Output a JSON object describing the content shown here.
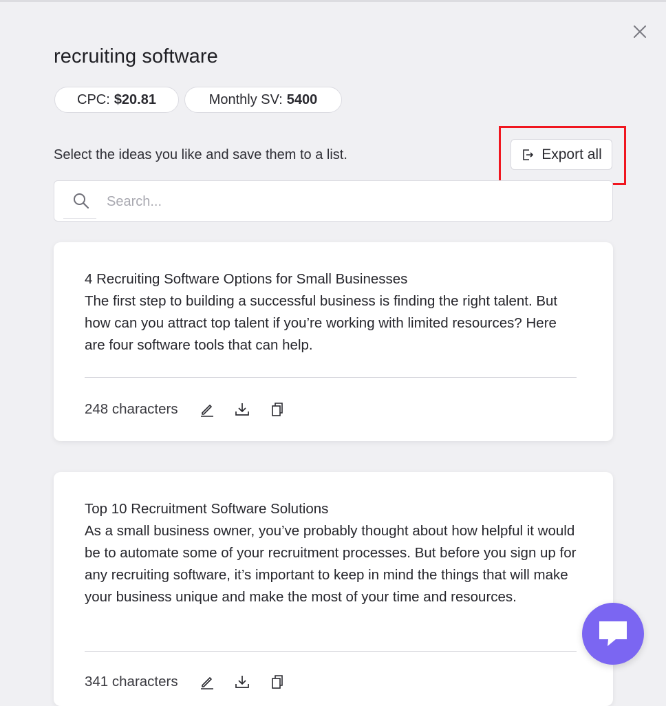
{
  "modal": {
    "title": "recruiting software",
    "close_icon": "close-icon"
  },
  "metrics": {
    "cpc_label": "CPC:",
    "cpc_value": "$20.81",
    "sv_label": "Monthly SV:",
    "sv_value": "5400"
  },
  "instructions": "Select the ideas you like and save them to a list.",
  "export": {
    "label": "Export all",
    "icon": "export-icon",
    "highlight_color": "#f0161f"
  },
  "search": {
    "placeholder": "Search...",
    "value": "",
    "icon": "search-icon"
  },
  "ideas": [
    {
      "title": "4 Recruiting Software Options for Small Businesses",
      "body": "The first step to building a successful business is finding the right talent. But how can you attract top talent if you’re working with limited resources? Here are four software tools that can help.",
      "char_count": "248 characters"
    },
    {
      "title": "Top 10 Recruitment Software Solutions",
      "body": "As a small business owner, you’ve probably thought about how helpful it would be to automate some of your recruitment processes. But before you sign up for any recruiting software, it’s important to keep in mind the things that will make your business unique and make the most of your time and resources.",
      "char_count": "341 characters"
    }
  ],
  "card_actions": [
    "edit-icon",
    "download-icon",
    "copy-icon"
  ],
  "chat": {
    "icon": "chat-icon",
    "color": "#7b66f2"
  }
}
